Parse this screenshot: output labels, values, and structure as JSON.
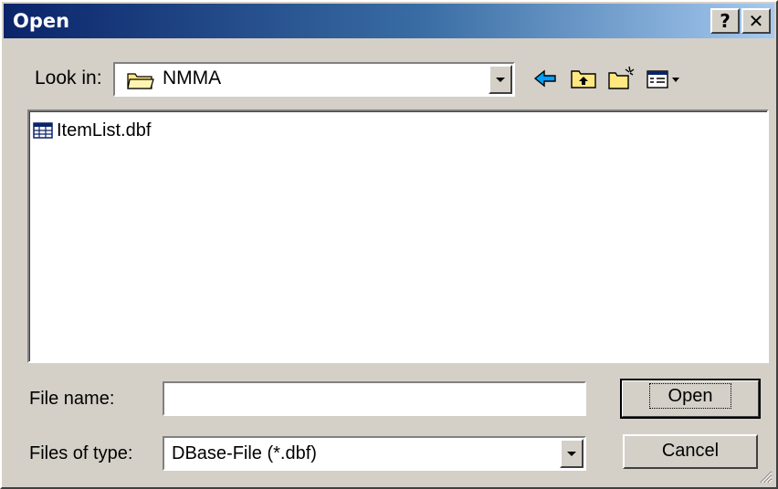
{
  "window": {
    "title": "Open"
  },
  "title_buttons": {
    "help_label": "?",
    "close_label": "✕"
  },
  "look_in": {
    "label": "Look in:",
    "folder": "NMMA"
  },
  "toolbar": {
    "icons": [
      "back-arrow-icon",
      "up-one-level-icon",
      "create-new-folder-icon",
      "view-menu-icon"
    ]
  },
  "file_list": {
    "items": [
      {
        "name": "ItemList.dbf",
        "icon": "dbf-table-icon"
      }
    ]
  },
  "file_name": {
    "label": "File name:",
    "value": ""
  },
  "files_of_type": {
    "label": "Files of type:",
    "value": "DBase-File (*.dbf)"
  },
  "buttons": {
    "open_label": "Open",
    "cancel_label": "Cancel"
  },
  "colors": {
    "title_start": "#0a246a",
    "title_end": "#a6caf0",
    "face": "#d4d0c8",
    "accent_arrow": "#00a0ff",
    "folder_yellow": "#ffe880"
  }
}
